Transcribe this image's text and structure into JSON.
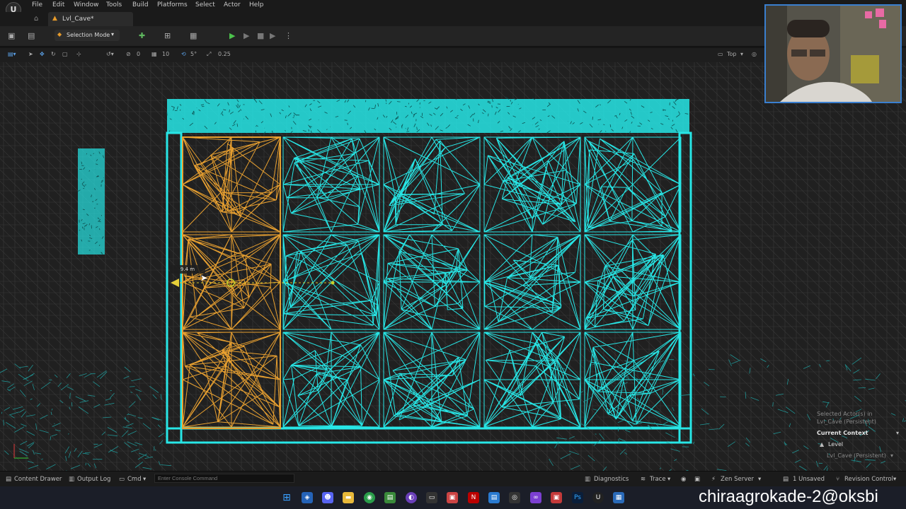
{
  "menu": {
    "items": [
      "File",
      "Edit",
      "Window",
      "Tools",
      "Build",
      "Platforms",
      "Select",
      "Actor",
      "Help"
    ]
  },
  "tab": {
    "level_name": "Lvl_Cave*"
  },
  "toolbar": {
    "selection_mode": "Selection Mode"
  },
  "viewport_toolbar": {
    "grid_snap": "10",
    "rotation_snap": "5°",
    "scale_snap": "0.25",
    "view_mode": "Top",
    "misc_zero": "0"
  },
  "viewport": {
    "measure_label": "9.4 m"
  },
  "context_panel": {
    "selected_line1": "Selected Actor(s) in",
    "selected_line2": "Lvl_Cave (Persistent)",
    "current_context": "Current Context",
    "level": "Level",
    "level_value": "Lvl_Cave (Persistent)"
  },
  "statusbar": {
    "content_drawer": "Content Drawer",
    "output_log": "Output Log",
    "cmd": "Cmd",
    "console_placeholder": "Enter Console Command",
    "diagnostics": "Diagnostics",
    "trace": "Trace",
    "zen_server": "Zen Server",
    "unsaved": "1 Unsaved",
    "revision_control": "Revision Control"
  },
  "overlay": {
    "watermark": "chiraagrokade-2@oksbi"
  },
  "colors": {
    "mesh_cyan": "#27e6e6",
    "mesh_selected": "#e8a030",
    "grid_line": "#3a3a3a",
    "accent": "#3a7fcf"
  }
}
